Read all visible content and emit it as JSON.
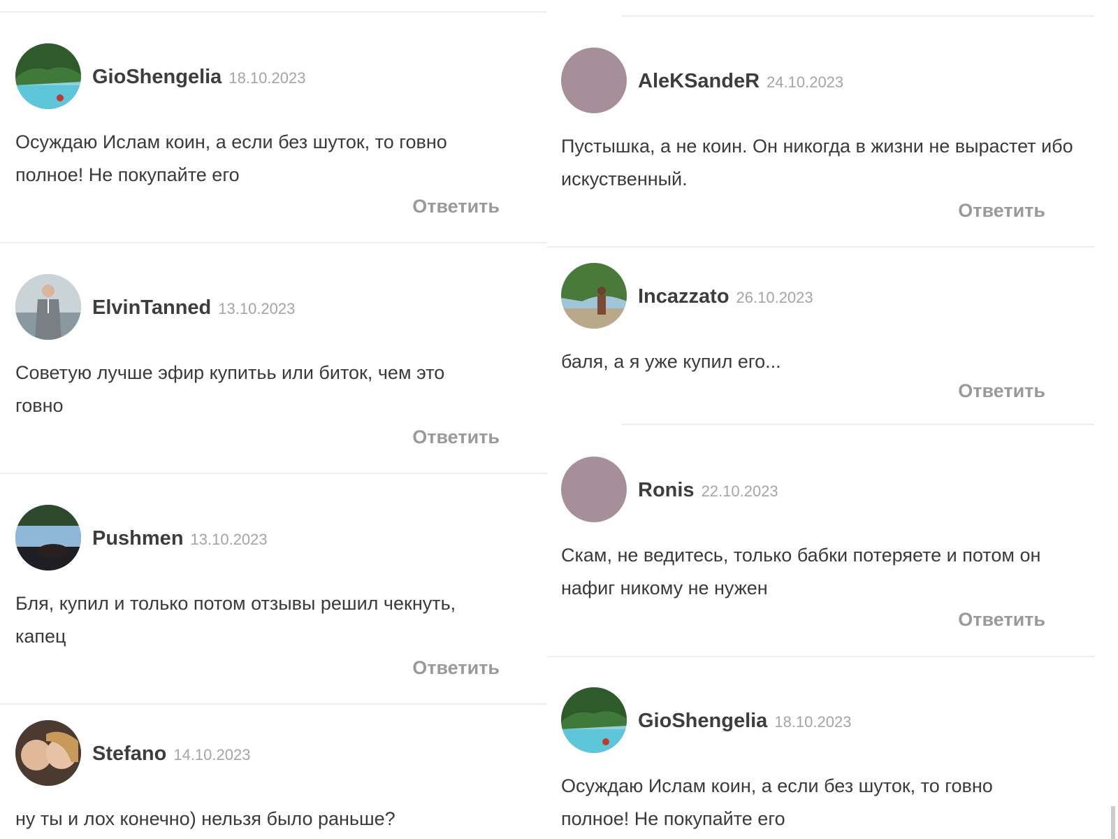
{
  "reply_label": "Ответить",
  "left_column": [
    {
      "author": "GioShengelia",
      "date": "18.10.2023",
      "avatar": "beach-photo-avatar",
      "text": "Осуждаю Ислам коин, а если без шуток, то говно полное! Не покупайте его"
    },
    {
      "author": "ElvinTanned",
      "date": "13.10.2023",
      "avatar": "man-in-suit-photo-avatar",
      "text": "Советую лучше эфир купитьь или биток, чем это говно"
    },
    {
      "author": "Pushmen",
      "date": "13.10.2023",
      "avatar": "pool-photo-avatar",
      "text": "Бля, купил и только потом отзывы решил чекнуть, капец"
    },
    {
      "author": "Stefano",
      "date": "14.10.2023",
      "avatar": "couple-photo-avatar",
      "text": "ну ты и лох конечно) нельзя было раньше?"
    }
  ],
  "right_column": [
    {
      "author": "AleKSandeR",
      "date": "24.10.2023",
      "avatar": "default-avatar",
      "text": "Пустышка, а не коин. Он никогда в жизни не вырастет ибо искуственный."
    },
    {
      "author": "Incazzato",
      "date": "26.10.2023",
      "avatar": "outdoor-photo-avatar",
      "text": "баля, а я уже купил его..."
    },
    {
      "author": "Ronis",
      "date": "22.10.2023",
      "avatar": "default-avatar",
      "text": "Скам, не ведитесь, только бабки потеряете и потом он нафиг никому не нужен"
    },
    {
      "author": "GioShengelia",
      "date": "18.10.2023",
      "avatar": "beach-photo-avatar",
      "text": "Осуждаю Ислам коин, а если без шуток, то говно полное! Не покупайте его"
    }
  ],
  "colors": {
    "default_avatar": "#a78f99",
    "reply": "#9a9a9a",
    "date": "#a5a5a5",
    "divider": "#eeeeee"
  }
}
